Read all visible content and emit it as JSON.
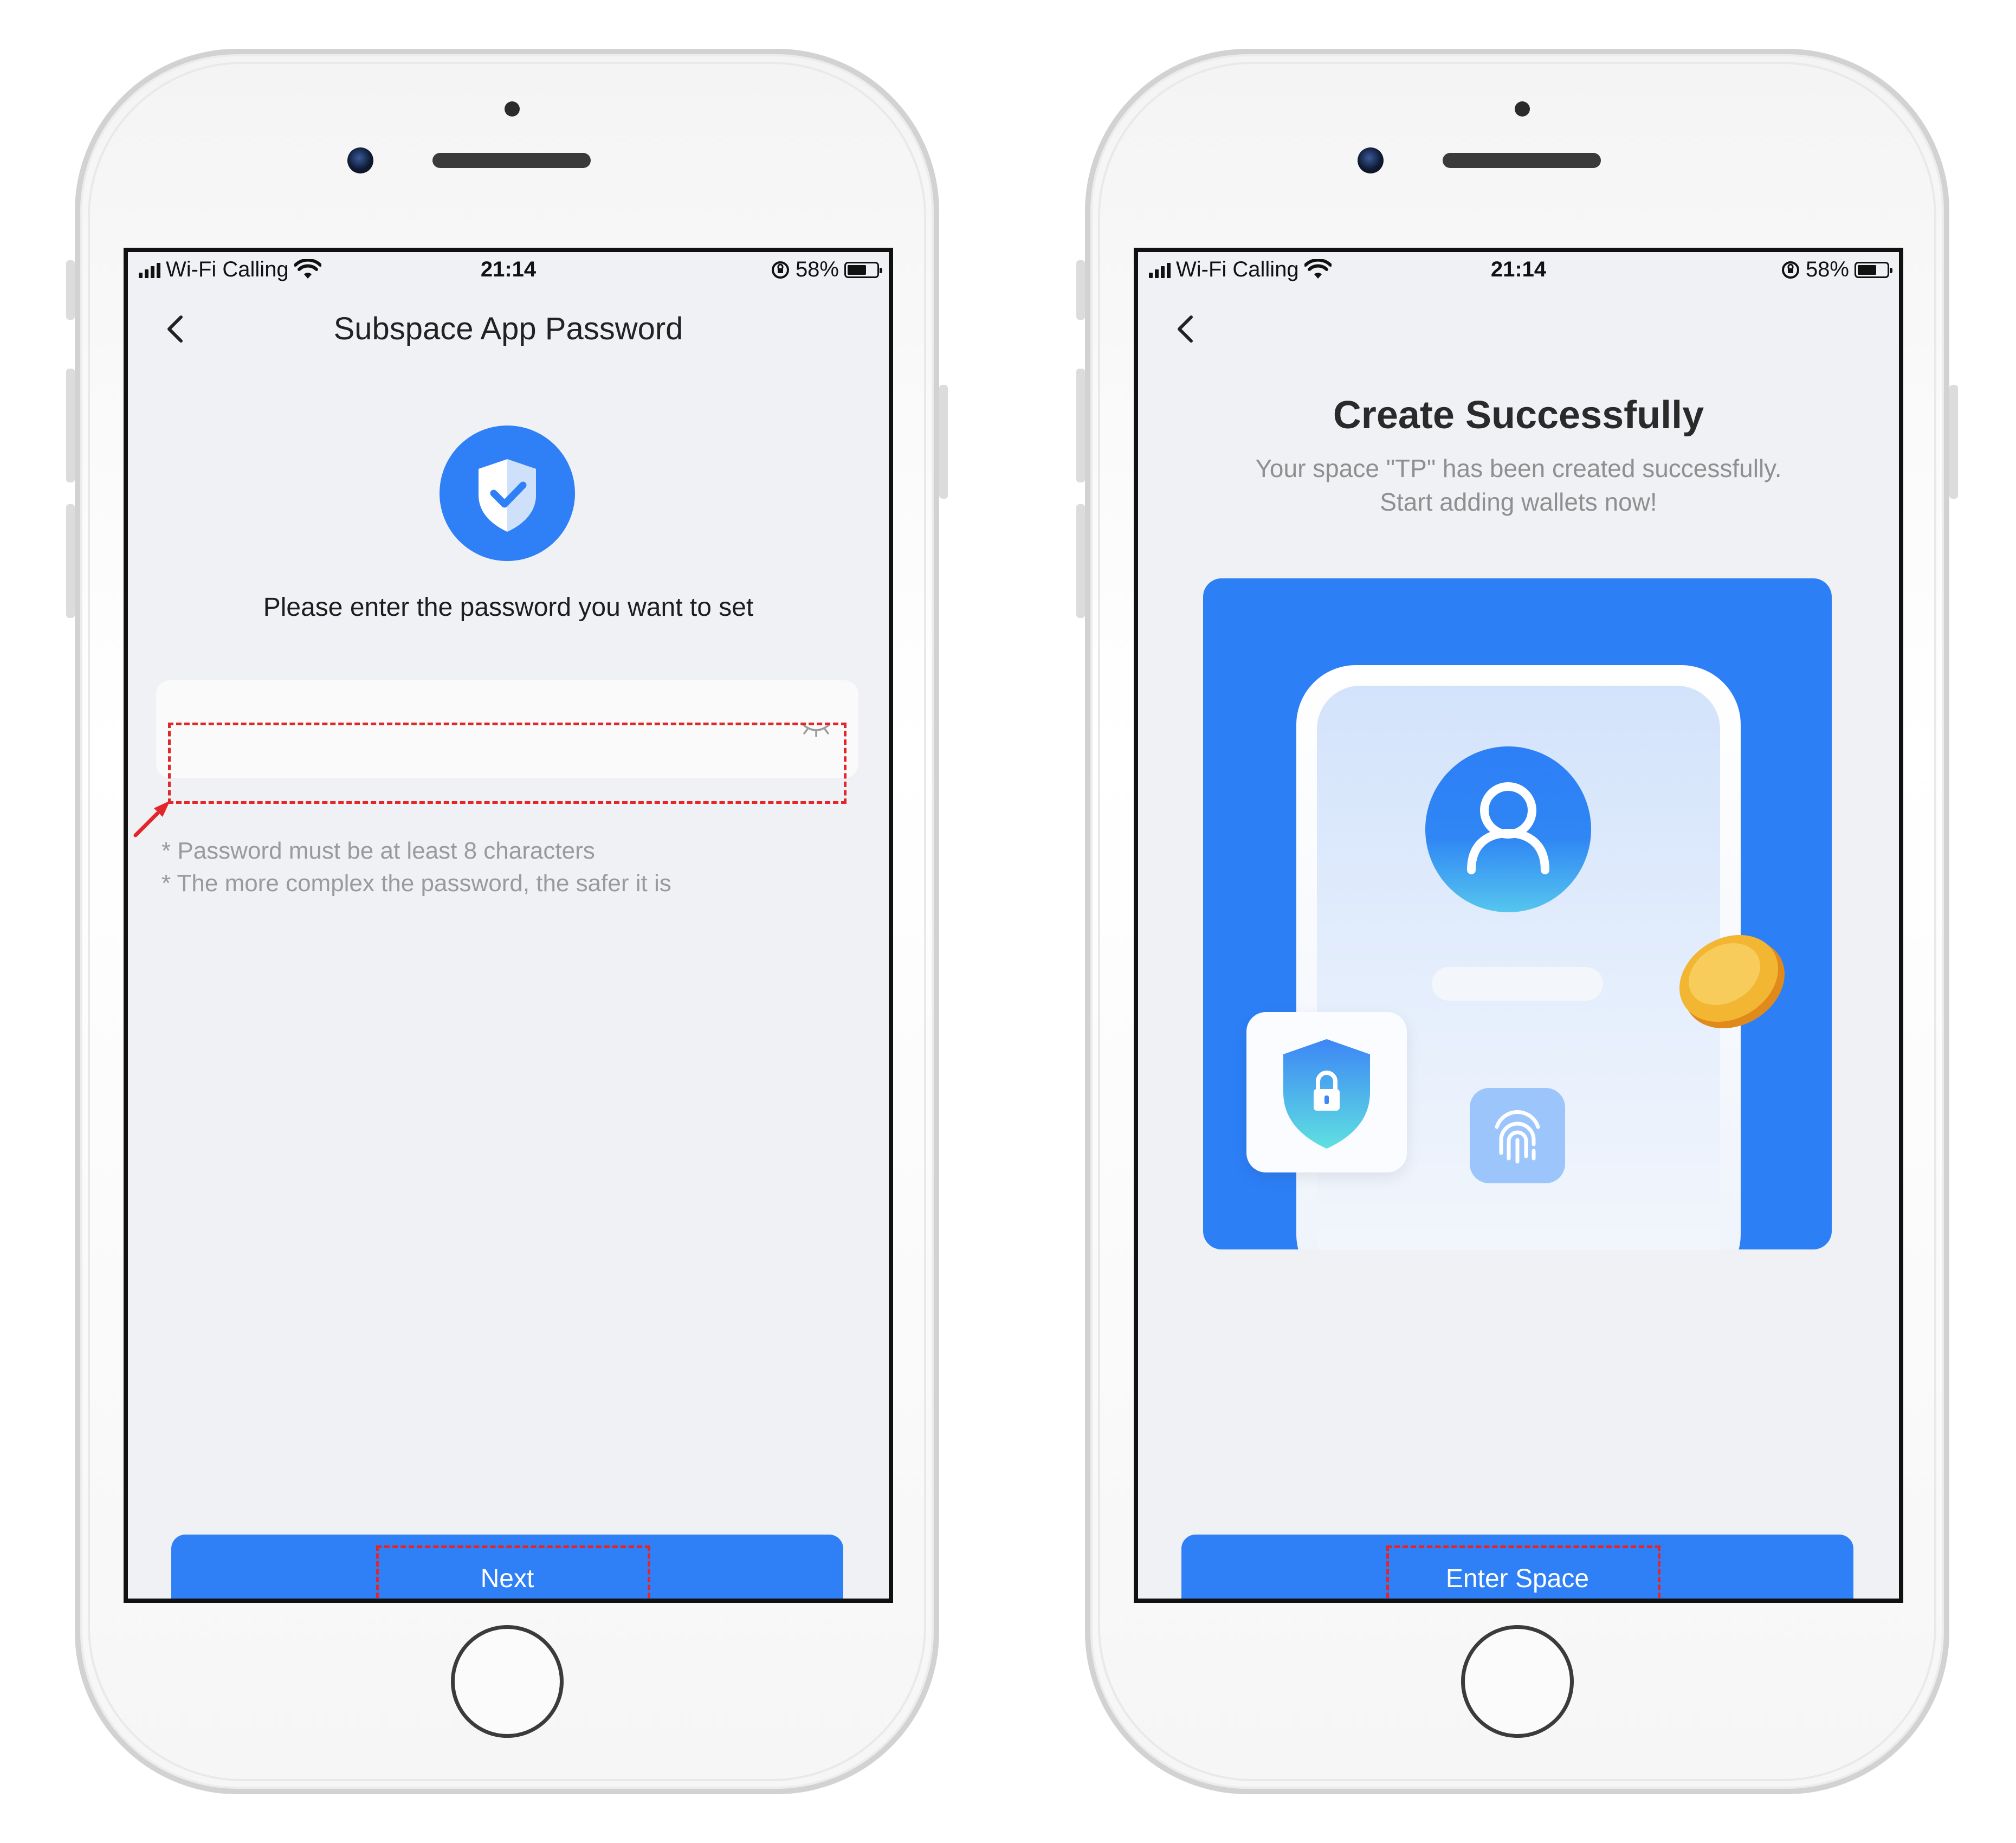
{
  "status_bar": {
    "carrier": "Wi-Fi Calling",
    "time": "21:14",
    "battery": "58%"
  },
  "left_screen": {
    "title": "Subspace App Password",
    "prompt": "Please enter the password you want to set",
    "password_value": "",
    "hints": [
      "* Password must be at least 8 characters",
      "* The more complex the password, the safer it is"
    ],
    "button_label": "Next"
  },
  "right_screen": {
    "title": "Create Successfully",
    "subtitle_lines": [
      "Your space \"TP\" has been created successfully.",
      "Start adding wallets now!"
    ],
    "button_label": "Enter Space"
  },
  "colors": {
    "accent": "#2f80f6",
    "screen_bg": "#f0f1f5",
    "highlight": "#e2262a",
    "coin": "#f2b632"
  },
  "icons": [
    "back-icon",
    "shield-check-icon",
    "eye-closed-icon",
    "wifi-icon",
    "signal-icon",
    "battery-icon",
    "orientation-lock-icon",
    "user-icon",
    "lock-shield-icon",
    "fingerprint-icon",
    "coin-icon"
  ]
}
